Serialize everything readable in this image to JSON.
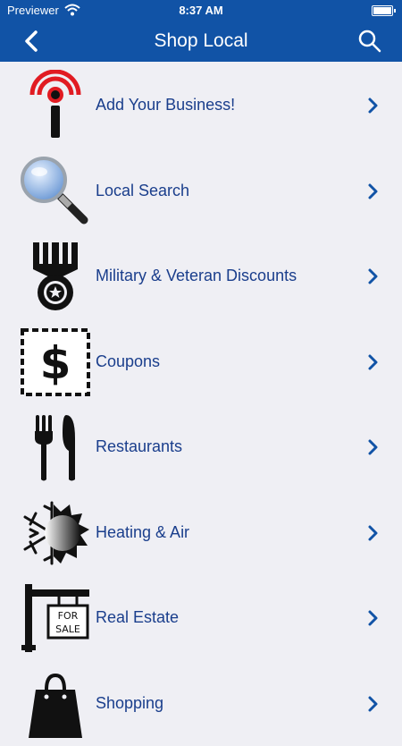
{
  "status_bar": {
    "carrier": "Previewer",
    "time": "8:37 AM"
  },
  "nav_bar": {
    "title": "Shop Local"
  },
  "items": [
    {
      "label": "Add Your Business!",
      "icon": "broadcast-info-icon"
    },
    {
      "label": "Local Search",
      "icon": "magnifier-icon"
    },
    {
      "label": "Military & Veteran Discounts",
      "icon": "medal-icon"
    },
    {
      "label": "Coupons",
      "icon": "coupon-dollar-icon"
    },
    {
      "label": "Restaurants",
      "icon": "fork-knife-icon"
    },
    {
      "label": "Heating & Air",
      "icon": "snowflake-sun-icon"
    },
    {
      "label": "Real Estate",
      "icon": "for-sale-sign-icon"
    },
    {
      "label": "Shopping",
      "icon": "shopping-bag-icon"
    }
  ],
  "real_estate_sign_text": [
    "FOR",
    "SALE"
  ],
  "colors": {
    "nav": "#1153a6",
    "label": "#1a3e8c",
    "chevron": "#1153a6",
    "background": "#efeff4"
  }
}
